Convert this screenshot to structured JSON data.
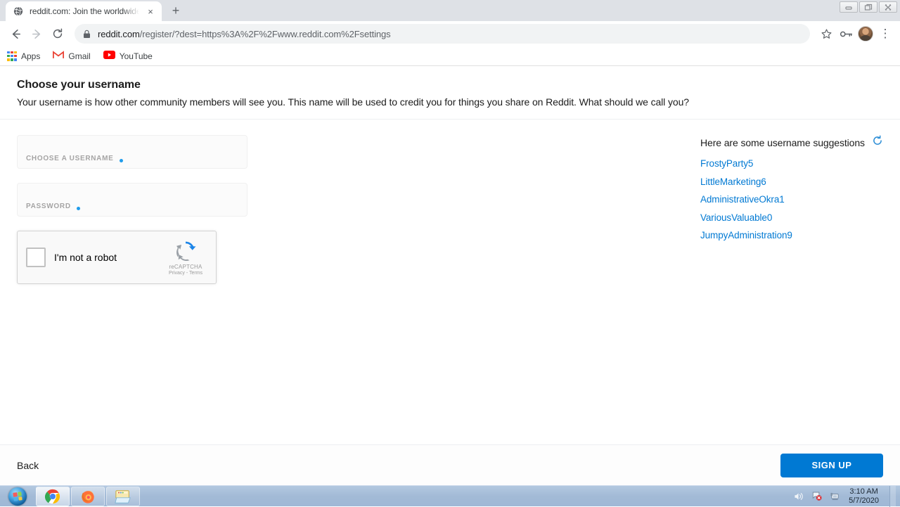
{
  "browser": {
    "tab": {
      "title": "reddit.com: Join the worldwide c",
      "favicon": "globe-icon",
      "close": "×"
    },
    "new_tab_label": "+",
    "window_controls": {
      "minimize": "–",
      "restore": "❐",
      "close": "✕"
    },
    "nav": {
      "back": "←",
      "forward": "→",
      "reload": "⟳"
    },
    "omnibox": {
      "host": "reddit.com",
      "path": "/register/?dest=https%3A%2F%2Fwww.reddit.com%2Fsettings",
      "full_url": "reddit.com/register/?dest=https%3A%2F%2Fwww.reddit.com%2Fsettings",
      "lock_icon": "lock-icon"
    },
    "toolbar_icons": [
      {
        "name": "bookmark-star-icon",
        "glyph": "☆"
      },
      {
        "name": "password-key-icon",
        "glyph": "⚷"
      },
      {
        "name": "profile-avatar",
        "glyph": ""
      },
      {
        "name": "chrome-menu-icon",
        "glyph": "⋮"
      }
    ],
    "bookmarks": [
      {
        "label": "Apps",
        "icon": "apps-grid-icon"
      },
      {
        "label": "Gmail",
        "icon": "gmail-icon"
      },
      {
        "label": "YouTube",
        "icon": "youtube-icon"
      }
    ]
  },
  "page": {
    "heading": "Choose your username",
    "subheading": "Your username is how other community members will see you. This name will be used to credit you for things you share on Reddit. What should we call you?",
    "form": {
      "username_field": {
        "label": "CHOOSE A USERNAME",
        "value": "",
        "required_marker": "•"
      },
      "password_field": {
        "label": "PASSWORD",
        "value": "",
        "required_marker": "•"
      }
    },
    "recaptcha": {
      "checkbox_label": "I'm not a robot",
      "brand": "reCAPTCHA",
      "links": "Privacy - Terms",
      "logo_icon": "recaptcha-logo-icon"
    },
    "suggestions": {
      "heading": "Here are some username suggestions",
      "refresh_icon": "refresh-icon",
      "items": [
        "FrostyParty5",
        "LittleMarketing6",
        "AdministrativeOkra1",
        "VariousValuable0",
        "JumpyAdministration9"
      ]
    },
    "footer": {
      "back_label": "Back",
      "signup_label": "SIGN UP"
    }
  },
  "taskbar": {
    "start_label": "start-orb",
    "items": [
      {
        "name": "taskbar-chrome",
        "icon": "chrome-icon"
      },
      {
        "name": "taskbar-firefox",
        "icon": "firefox-icon"
      },
      {
        "name": "taskbar-explorer",
        "icon": "explorer-icon"
      }
    ],
    "tray": [
      {
        "name": "volume-icon"
      },
      {
        "name": "action-center-flag-icon"
      },
      {
        "name": "network-icon"
      }
    ],
    "clock": {
      "time": "3:10 AM",
      "date": "5/7/2020"
    }
  },
  "colors": {
    "reddit_blue": "#0079d3",
    "link_blue": "#0079d3",
    "chrome_tabstrip": "#dee1e6",
    "taskbar": "#a2bad6"
  }
}
